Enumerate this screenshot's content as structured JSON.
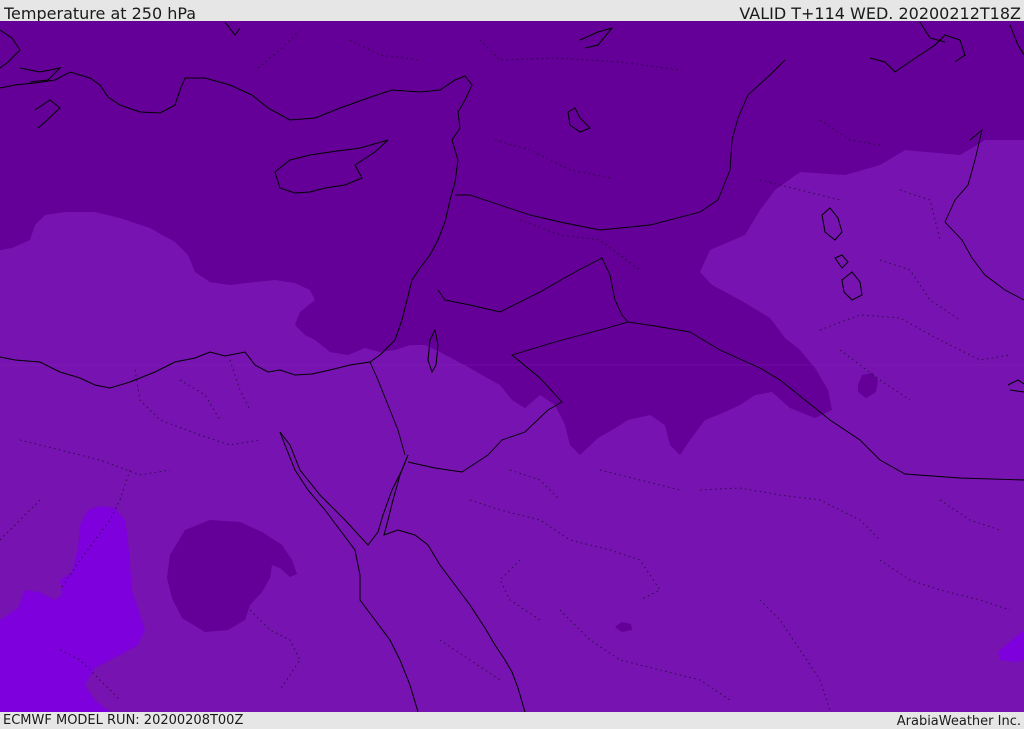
{
  "header": {
    "title": "Temperature at 250 hPa",
    "valid": "VALID T+114 WED. 20200212T18Z"
  },
  "footer": {
    "model_run": "ECMWF MODEL RUN: 20200208T00Z",
    "credit": "ArabiaWeather Inc."
  },
  "colors": {
    "band_cold": "#640097",
    "band_mid": "#7713b0",
    "band_warm": "#7e00dc",
    "coastline": "#000000",
    "frame": "#e6e6e6"
  }
}
